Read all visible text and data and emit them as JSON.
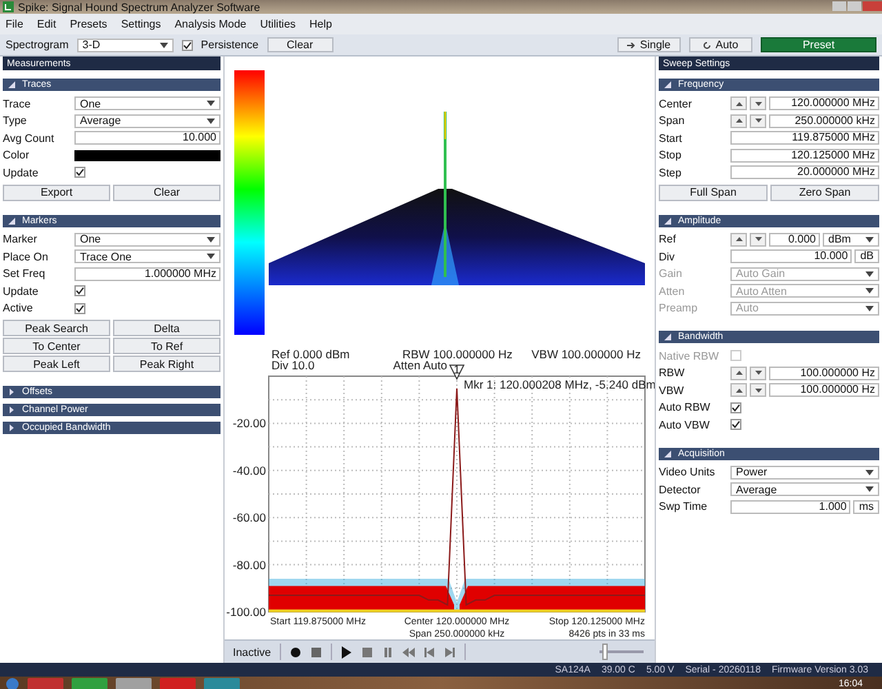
{
  "window": {
    "title": "Spike: Signal Hound Spectrum Analyzer Software"
  },
  "menu": [
    "File",
    "Edit",
    "Presets",
    "Settings",
    "Analysis Mode",
    "Utilities",
    "Help"
  ],
  "toolbar": {
    "spectrogram_label": "Spectrogram",
    "spectrogram_value": "3-D",
    "persistence": {
      "label": "Persistence",
      "checked": true
    },
    "clear": "Clear",
    "single": "Single",
    "auto": "Auto",
    "preset": "Preset"
  },
  "left_panel": {
    "title": "Measurements",
    "sections": [
      {
        "title": "Traces",
        "expanded": true,
        "rows": [
          {
            "kind": "select",
            "label": "Trace",
            "value": "One",
            "disabled": false
          },
          {
            "kind": "select",
            "label": "Type",
            "value": "Average",
            "disabled": false
          },
          {
            "kind": "number",
            "label": "Avg Count",
            "value": "10.000",
            "disabled": false
          },
          {
            "kind": "color",
            "label": "Color",
            "color": "#000000",
            "disabled": false
          },
          {
            "kind": "check",
            "label": "Update",
            "checked": true,
            "disabled": false
          }
        ],
        "buttons": [
          "Export",
          "Clear"
        ]
      },
      {
        "title": "Markers",
        "expanded": true,
        "rows": [
          {
            "kind": "select",
            "label": "Marker",
            "value": "One",
            "disabled": false
          },
          {
            "kind": "select",
            "label": "Place On",
            "value": "Trace One",
            "disabled": false
          },
          {
            "kind": "number",
            "label": "Set Freq",
            "value": "1.000000 MHz",
            "disabled": false
          },
          {
            "kind": "check",
            "label": "Update",
            "checked": true,
            "disabled": false
          },
          {
            "kind": "check",
            "label": "Active",
            "checked": true,
            "disabled": false
          }
        ],
        "buttons": [
          "Peak Search",
          "Delta",
          "To Center",
          "To Ref",
          "Peak Left",
          "Peak Right"
        ]
      },
      {
        "title": "Offsets",
        "expanded": false
      },
      {
        "title": "Channel Power",
        "expanded": false
      },
      {
        "title": "Occupied Bandwidth",
        "expanded": false
      }
    ]
  },
  "right_panel": {
    "title": "Sweep Settings",
    "sections": [
      {
        "title": "Frequency",
        "expanded": true,
        "rows": [
          {
            "kind": "stepper",
            "label": "Center",
            "value": "120.000000 MHz",
            "disabled": false
          },
          {
            "kind": "stepper",
            "label": "Span",
            "value": "250.000000 kHz",
            "disabled": false
          },
          {
            "kind": "number",
            "label": "Start",
            "value": "119.875000 MHz",
            "disabled": false
          },
          {
            "kind": "number",
            "label": "Stop",
            "value": "120.125000 MHz",
            "disabled": false
          },
          {
            "kind": "number",
            "label": "Step",
            "value": "20.000000 MHz",
            "disabled": false
          }
        ],
        "buttons": [
          "Full Span",
          "Zero Span"
        ]
      },
      {
        "title": "Amplitude",
        "expanded": true,
        "rows": [
          {
            "kind": "stepper",
            "label": "Ref",
            "value": "0.000",
            "unit": "dBm",
            "unit_dropdown": true,
            "disabled": false
          },
          {
            "kind": "number",
            "label": "Div",
            "value": "10.000",
            "unit": "dB",
            "unit_dropdown": false,
            "disabled": false
          },
          {
            "kind": "select",
            "label": "Gain",
            "value": "Auto Gain",
            "disabled": true
          },
          {
            "kind": "select",
            "label": "Atten",
            "value": "Auto Atten",
            "disabled": true
          },
          {
            "kind": "select",
            "label": "Preamp",
            "value": "Auto",
            "disabled": true
          }
        ]
      },
      {
        "title": "Bandwidth",
        "expanded": true,
        "rows": [
          {
            "kind": "check",
            "label": "Native RBW",
            "checked": false,
            "disabled": true
          },
          {
            "kind": "stepper",
            "label": "RBW",
            "value": "100.000000 Hz",
            "disabled": false
          },
          {
            "kind": "stepper",
            "label": "VBW",
            "value": "100.000000 Hz",
            "disabled": false
          },
          {
            "kind": "check",
            "label": "Auto RBW",
            "checked": true,
            "disabled": false
          },
          {
            "kind": "check",
            "label": "Auto VBW",
            "checked": true,
            "disabled": false
          }
        ]
      },
      {
        "title": "Acquisition",
        "expanded": true,
        "rows": [
          {
            "kind": "select",
            "label": "Video Units",
            "value": "Power",
            "disabled": false
          },
          {
            "kind": "select",
            "label": "Detector",
            "value": "Average",
            "disabled": false
          },
          {
            "kind": "number",
            "label": "Swp Time",
            "value": "1.000",
            "unit": "ms",
            "unit_dropdown": false,
            "disabled": false
          }
        ]
      }
    ]
  },
  "plot": {
    "ref": "Ref 0.000 dBm",
    "div": "Div 10.0",
    "rbw": "RBW 100.000000 Hz",
    "atten": "Atten Auto",
    "vbw": "VBW 100.000000 Hz",
    "marker_number": "1",
    "marker_readout": "Mkr 1: 120.000208 MHz, -5.240 dBm",
    "start": "Start 119.875000 MHz",
    "center": "Center 120.000000 MHz",
    "stop": "Stop 120.125000 MHz",
    "span": "Span 250.000000 kHz",
    "points": "8426 pts in 33 ms",
    "chart_data": {
      "type": "line",
      "categories": [
        null,
        null,
        null,
        null,
        null,
        null,
        null,
        null,
        null,
        null,
        null,
        null,
        null,
        null,
        null,
        null,
        null,
        null,
        null,
        null,
        null,
        null,
        null,
        null,
        null,
        null,
        null,
        null,
        null,
        null,
        null,
        null,
        null,
        null,
        null,
        null,
        null,
        null,
        null,
        null,
        null
      ],
      "series": [
        {
          "color": "#8b1a1a",
          "values": [
            -93,
            -93,
            -93,
            -93,
            -93,
            -93,
            -93,
            -93,
            -93,
            -93,
            -93,
            -93,
            -93,
            -93,
            -93,
            -93,
            -93,
            -95,
            -95,
            -97,
            -5.2,
            -97,
            -95,
            -95,
            -93,
            -93,
            -93,
            -93,
            -93,
            -93,
            -93,
            -93,
            -93,
            -93,
            -93,
            -93,
            -93,
            -93,
            -93,
            -93,
            -93
          ]
        }
      ],
      "ylim": [
        -100,
        0
      ],
      "grid": true,
      "yticks": [
        {
          "value": -20,
          "label": "-20.00"
        },
        {
          "value": -40,
          "label": "-40.00"
        },
        {
          "value": -60,
          "label": "-60.00"
        },
        {
          "value": -80,
          "label": "-80.00"
        },
        {
          "value": -100,
          "label": "-100.00"
        }
      ]
    }
  },
  "playback": {
    "status": "Inactive",
    "level": 0.05
  },
  "status_bar": [
    "SA124A",
    "39.00 C",
    "5.00 V",
    "Serial - 20260118",
    "Firmware Version 3.03"
  ],
  "taskbar": {
    "clock": "16:04"
  }
}
